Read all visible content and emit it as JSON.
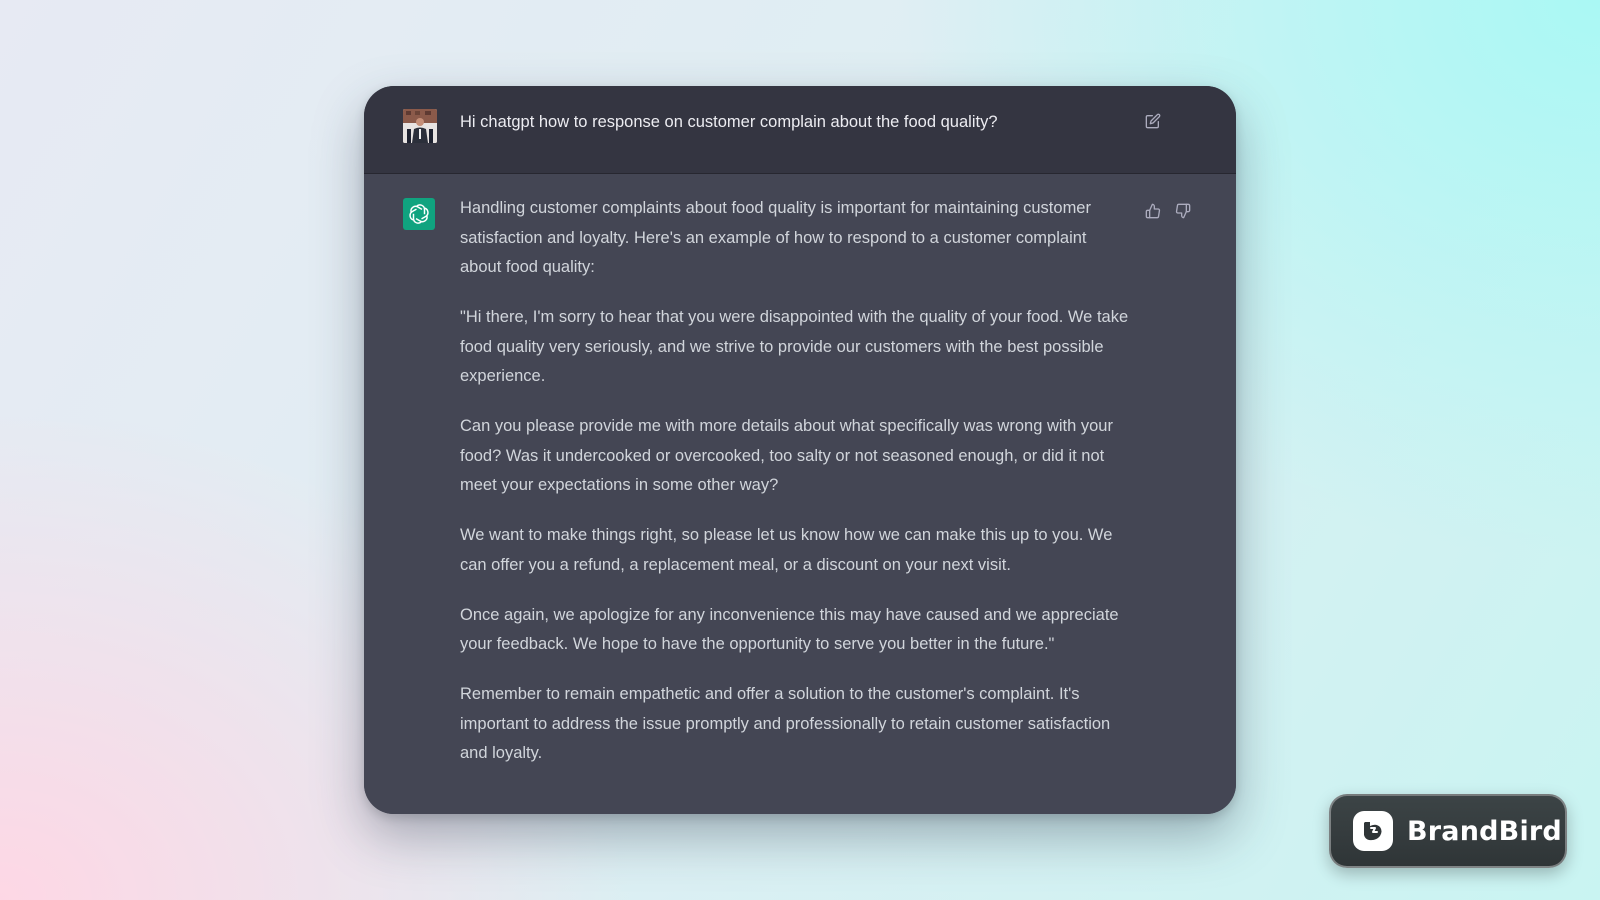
{
  "chat": {
    "user_message": "Hi chatgpt how to response on customer complain about the food quality?",
    "assistant_paragraphs": [
      "Handling customer complaints about food quality is important for maintaining customer satisfaction and loyalty. Here's an example of how to respond to a customer complaint about food quality:",
      "\"Hi there, I'm sorry to hear that you were disappointed with the quality of your food. We take food quality very seriously, and we strive to provide our customers with the best possible experience.",
      "Can you please provide me with more details about what specifically was wrong with your food? Was it undercooked or overcooked, too salty or not seasoned enough, or did it not meet your expectations in some other way?",
      "We want to make things right, so please let us know how we can make this up to you. We can offer you a refund, a replacement meal, or a discount on your next visit.",
      "Once again, we apologize for any inconvenience this may have caused and we appreciate your feedback. We hope to have the opportunity to serve you better in the future.\"",
      "Remember to remain empathetic and offer a solution to the customer's complaint. It's important to address the issue promptly and professionally to retain customer satisfaction and loyalty."
    ],
    "icons": {
      "edit": "edit-icon",
      "thumbs_up": "thumbs-up-icon",
      "thumbs_down": "thumbs-down-icon",
      "assistant_logo": "openai-logo-icon"
    },
    "colors": {
      "user_row_bg": "#343541",
      "assistant_row_bg": "#444654",
      "assistant_avatar_bg": "#10a37f",
      "text": "#d1d5db"
    }
  },
  "watermark": {
    "brand_name": "BrandBird"
  }
}
